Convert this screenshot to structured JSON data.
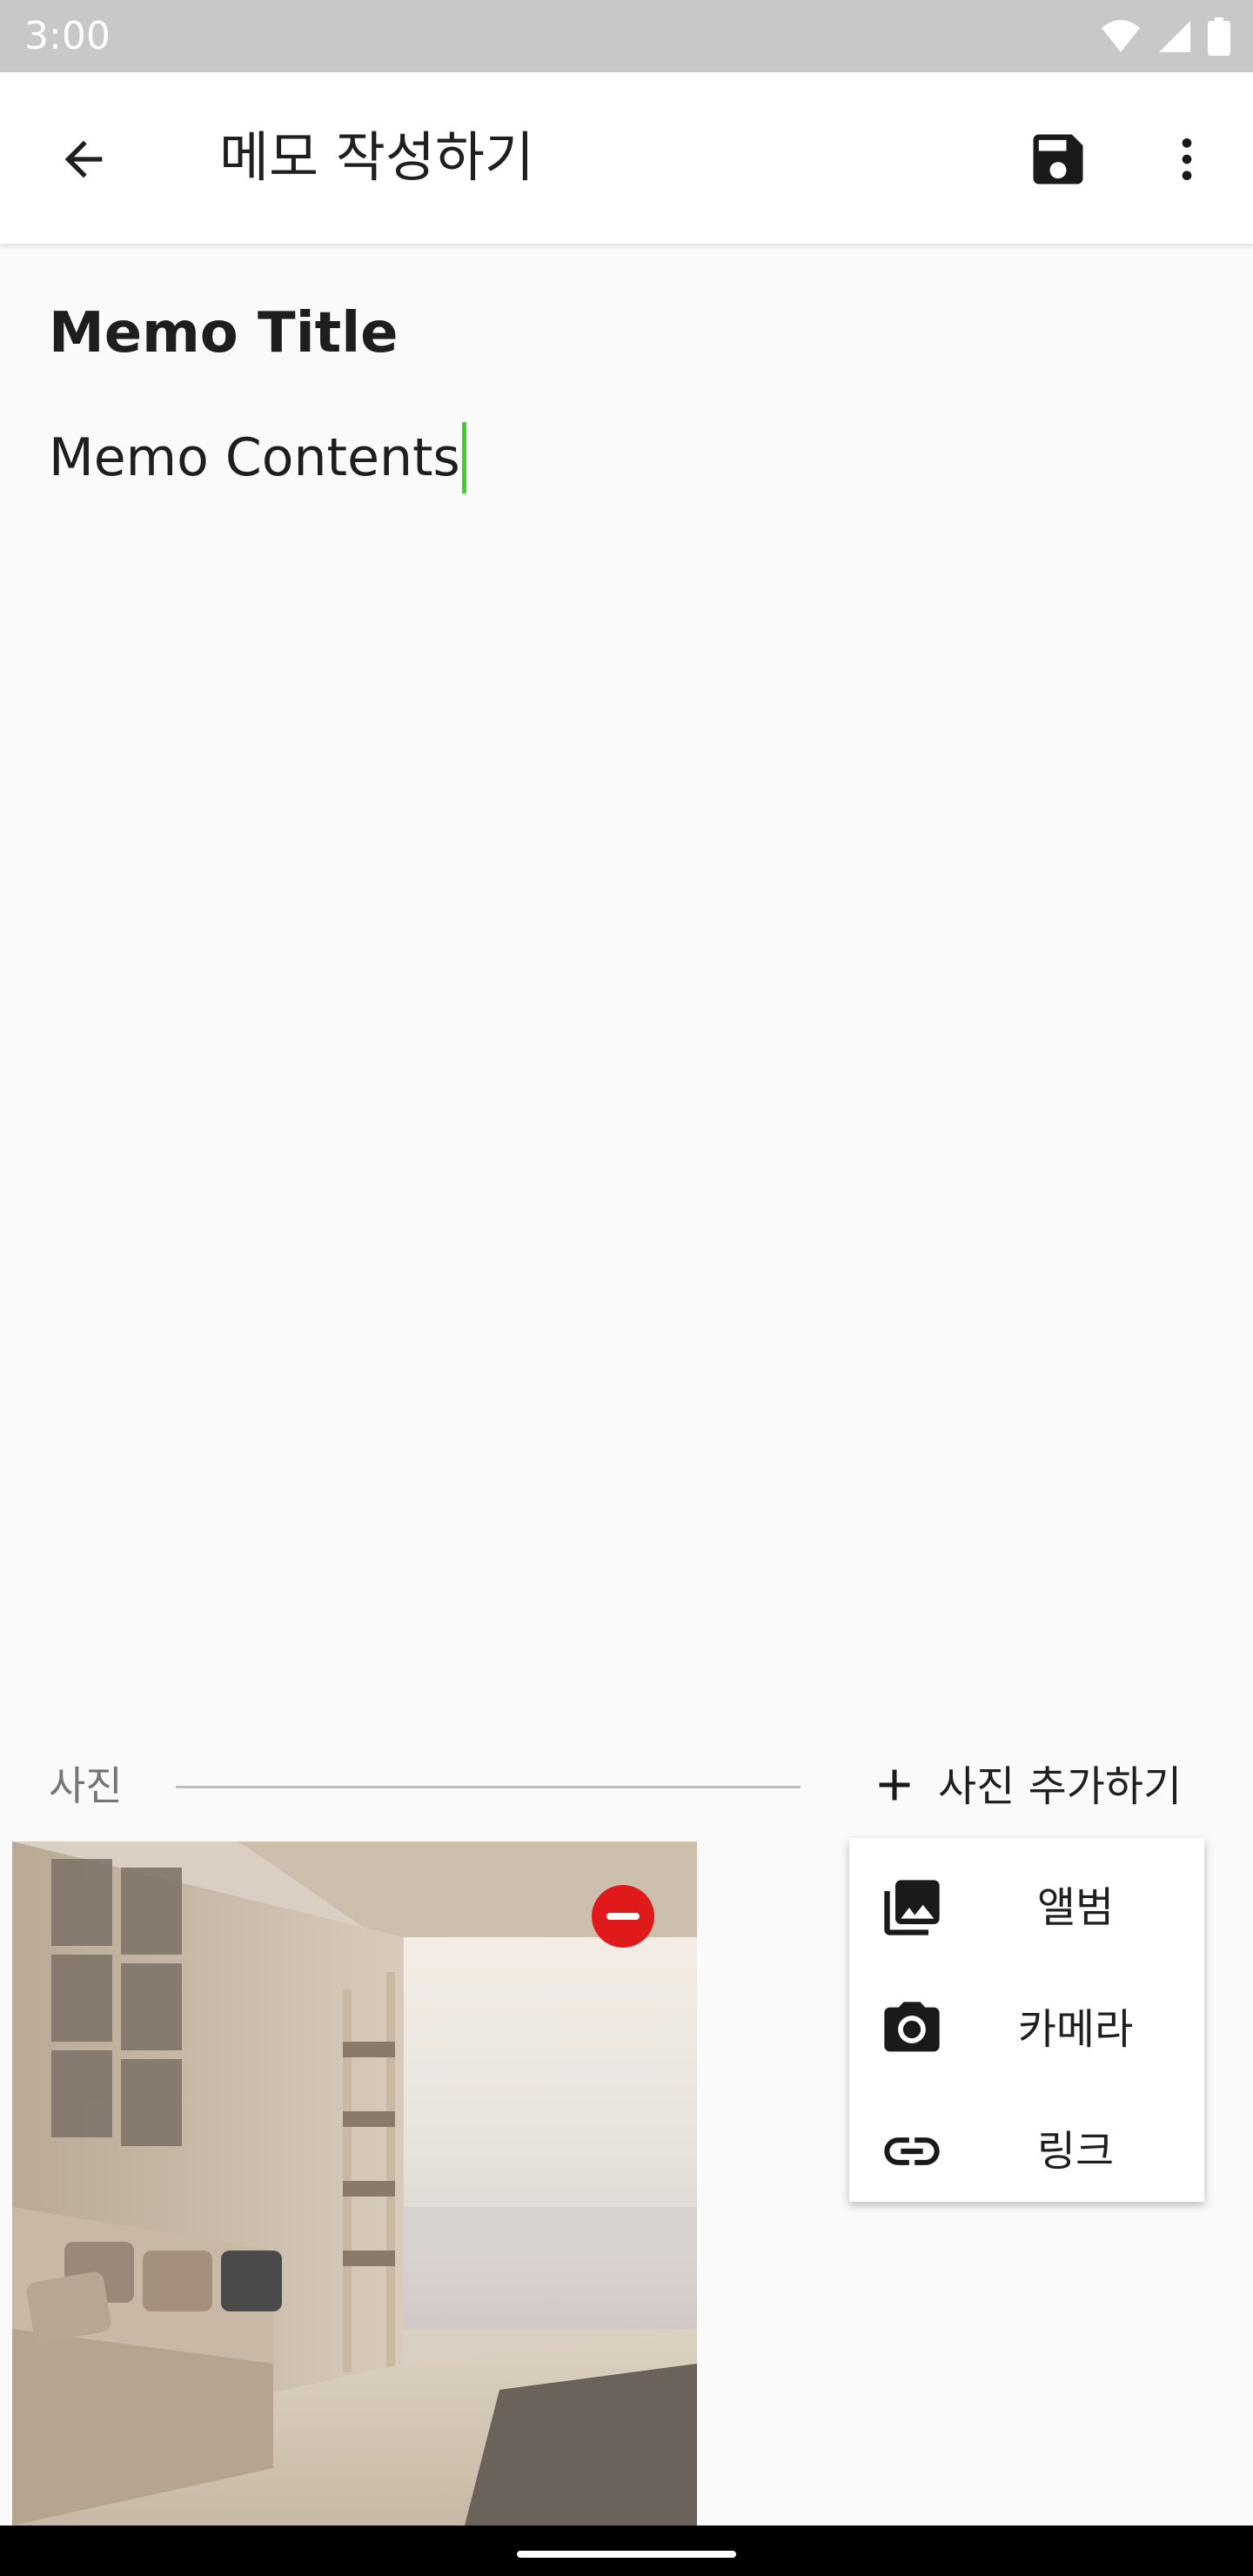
{
  "status_bar": {
    "time": "3:00"
  },
  "app_bar": {
    "title": "메모 작성하기",
    "back_icon": "arrow-back-icon",
    "save_icon": "save-floppy-icon",
    "more_icon": "more-vert-icon"
  },
  "memo": {
    "title": "Memo Title",
    "contents": "Memo Contents",
    "cursor_color": "#3fcf2a"
  },
  "photos": {
    "section_label": "사진",
    "add_label": "사진 추가하기",
    "remove_color": "#e01a1a"
  },
  "add_menu": {
    "items": [
      {
        "label": "앨범",
        "icon": "photo-library-icon"
      },
      {
        "label": "카메라",
        "icon": "camera-icon"
      },
      {
        "label": "링크",
        "icon": "link-icon"
      }
    ]
  }
}
